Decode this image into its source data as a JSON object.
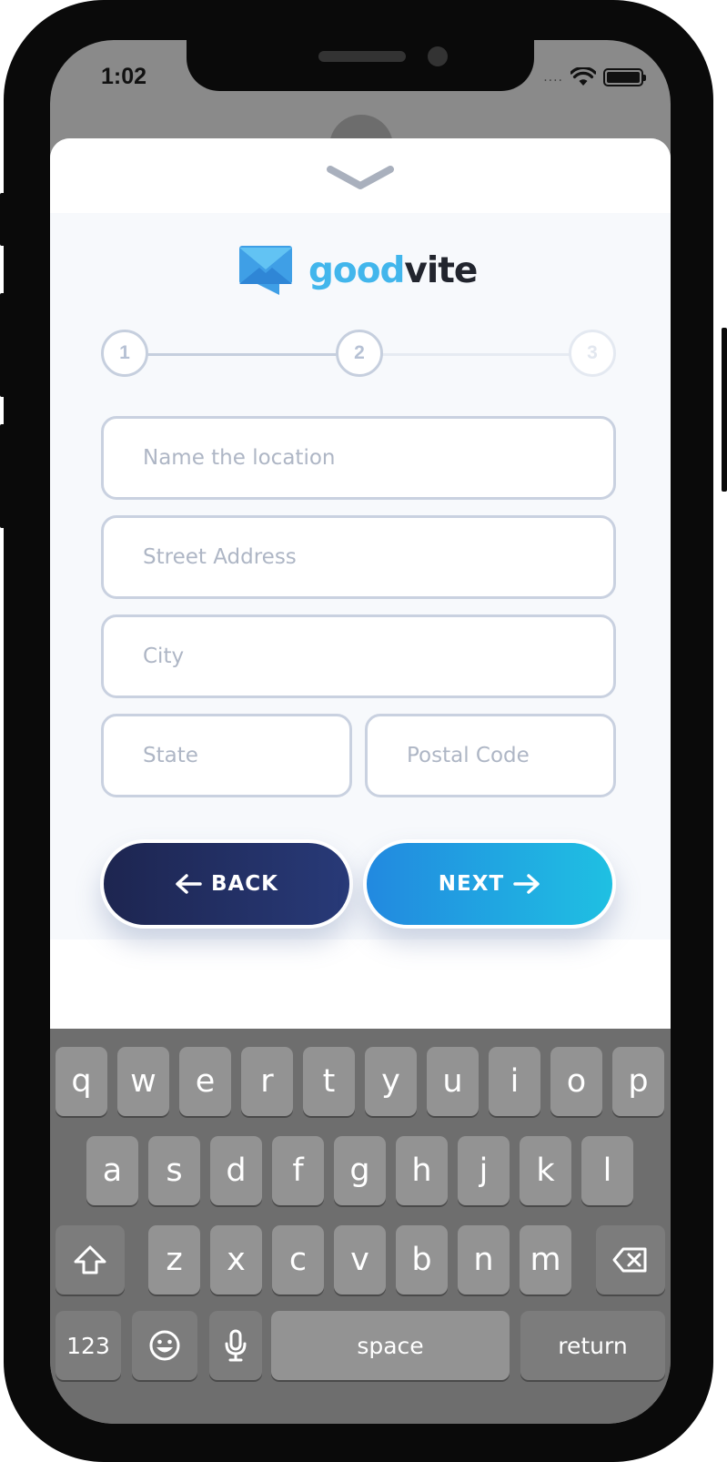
{
  "status_bar": {
    "time": "1:02",
    "signal": "....",
    "battery_level": 1.0
  },
  "app": {
    "logo_part1": "good",
    "logo_part2": "vite"
  },
  "steps": [
    {
      "label": "1"
    },
    {
      "label": "2"
    },
    {
      "label": "3"
    }
  ],
  "form": {
    "name_placeholder": "Name the location",
    "street_placeholder": "Street Address",
    "city_placeholder": "City",
    "state_placeholder": "State",
    "postal_placeholder": "Postal Code"
  },
  "buttons": {
    "back": "BACK",
    "next": "NEXT"
  },
  "keyboard": {
    "row1": [
      "q",
      "w",
      "e",
      "r",
      "t",
      "y",
      "u",
      "i",
      "o",
      "p"
    ],
    "row2": [
      "a",
      "s",
      "d",
      "f",
      "g",
      "h",
      "j",
      "k",
      "l"
    ],
    "row3": [
      "z",
      "x",
      "c",
      "v",
      "b",
      "n",
      "m"
    ],
    "numbers": "123",
    "space": "space",
    "return": "return"
  },
  "colors": {
    "brand_blue": "#42b6ec",
    "back_button": "#1d2550",
    "next_button_start": "#2289e0",
    "next_button_end": "#1fc0e2"
  },
  "icons": [
    "chevron-down-icon",
    "wifi-icon",
    "battery-icon",
    "envelope-logo-icon",
    "arrow-left-icon",
    "arrow-right-icon",
    "shift-icon",
    "backspace-icon",
    "emoji-icon",
    "microphone-icon"
  ]
}
